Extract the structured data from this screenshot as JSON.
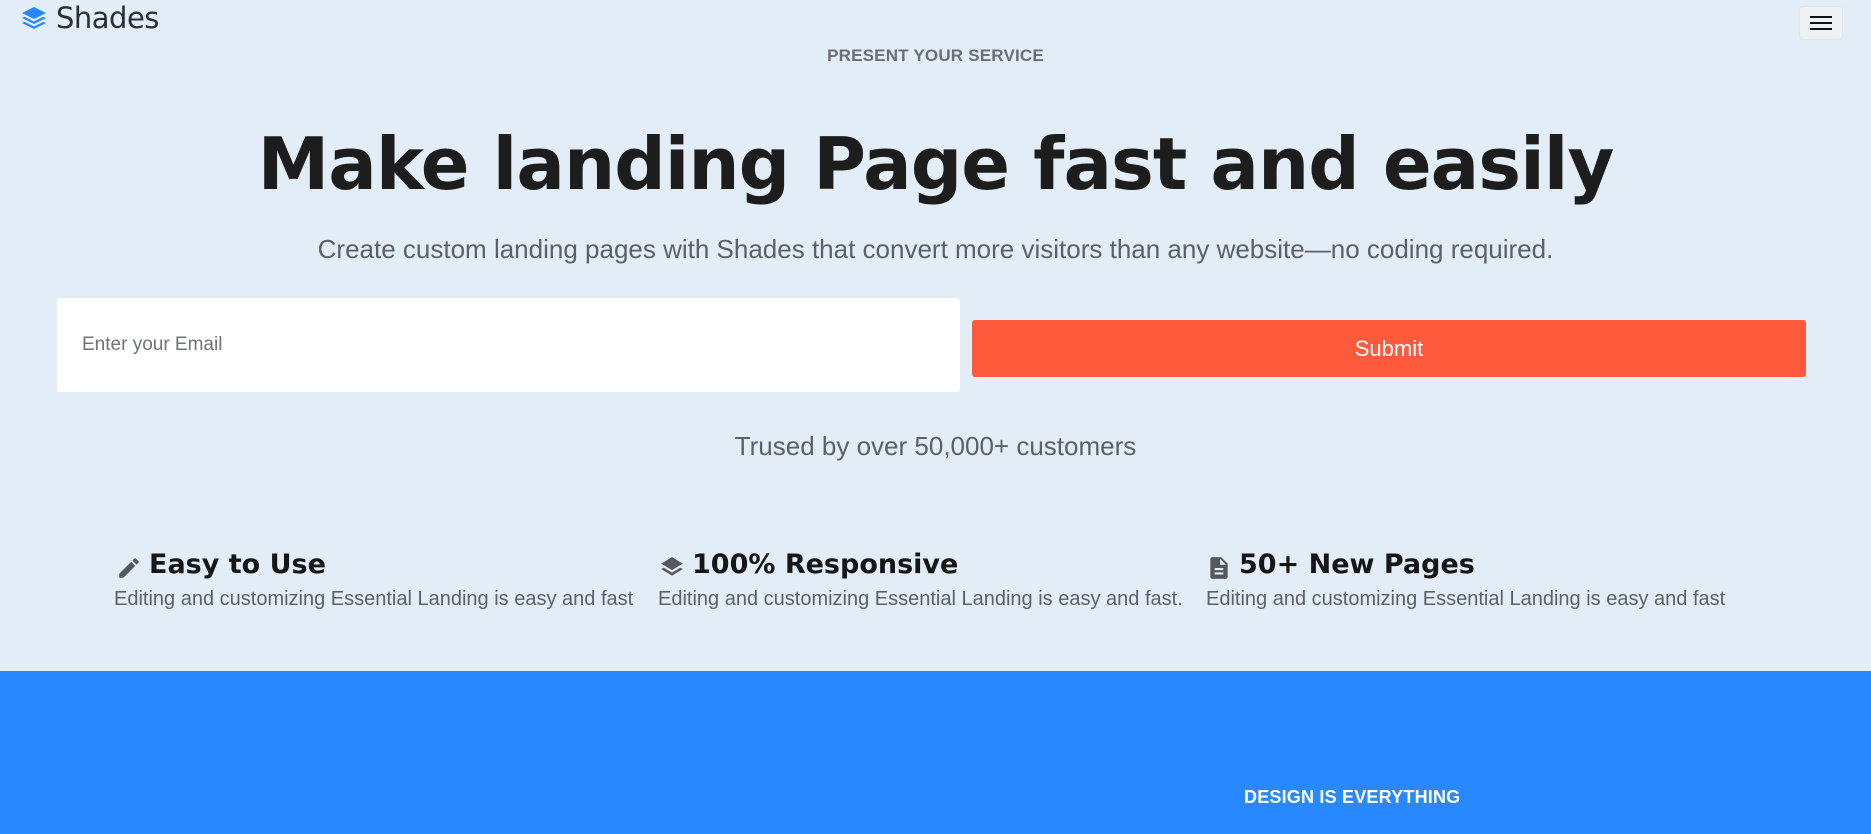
{
  "brand": {
    "name": "Shades",
    "logo_icon": "layers-icon",
    "accent": "#2788ff"
  },
  "nav": {
    "menu_icon": "hamburger-icon"
  },
  "hero": {
    "eyebrow": "PRESENT YOUR SERVICE",
    "title": "Make landing Page fast and easily",
    "subtitle": "Create custom landing pages with Shades that convert more visitors than any website—no coding required."
  },
  "signup": {
    "email_placeholder": "Enter your Email",
    "email_value": "",
    "submit_label": "Submit",
    "submit_color": "#ff5a3c"
  },
  "trusted": "Trused by over 50,000+ customers",
  "features": [
    {
      "icon": "pencil-icon",
      "title": "Easy to Use",
      "description": "Editing and customizing Essential Landing is easy and fast"
    },
    {
      "icon": "layers-icon",
      "title": "100% Responsive",
      "description": "Editing and customizing Essential Landing is easy and fast."
    },
    {
      "icon": "document-icon",
      "title": "50+ New Pages",
      "description": "Editing and customizing Essential Landing is easy and fast"
    }
  ],
  "next_section": {
    "eyebrow": "DESIGN IS EVERYTHING",
    "background": "#2788ff"
  },
  "colors": {
    "page_background": "#e3edf8",
    "text_dark": "#1d1d1d",
    "text_muted": "#5c6167"
  }
}
